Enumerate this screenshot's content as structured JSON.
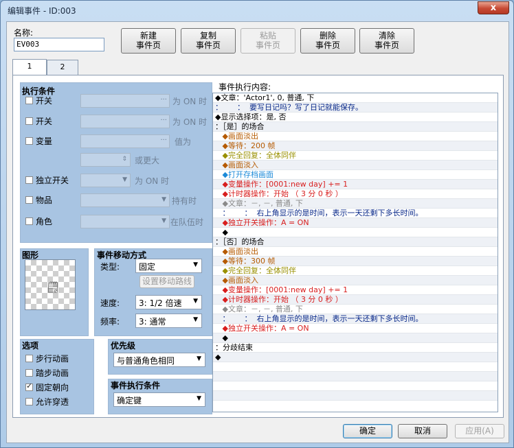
{
  "window": {
    "title": "编辑事件 - ID:003",
    "close_label": "x"
  },
  "header": {
    "name_label": "名称:",
    "name_value": "EV003",
    "buttons": [
      {
        "label1": "新建",
        "label2": "事件页"
      },
      {
        "label1": "复制",
        "label2": "事件页"
      },
      {
        "label1": "粘贴",
        "label2": "事件页"
      },
      {
        "label1": "删除",
        "label2": "事件页"
      },
      {
        "label1": "清除",
        "label2": "事件页"
      }
    ]
  },
  "tabs": [
    "1",
    "2"
  ],
  "conditions": {
    "title": "执行条件",
    "switch1": "开关",
    "switch1_hint": "为 ON 时",
    "switch2": "开关",
    "switch2_hint": "为 ON 时",
    "variable": "变量",
    "variable_hint": "值为",
    "variable_hint2": "或更大",
    "self_switch": "独立开关",
    "self_switch_hint": "为 ON 时",
    "item": "物品",
    "item_hint": "持有时",
    "actor": "角色",
    "actor_hint": "在队伍时"
  },
  "graphic": {
    "title": "图形"
  },
  "movement": {
    "title": "事件移动方式",
    "type_label": "类型:",
    "type_value": "固定",
    "route_button": "设置移动路线",
    "speed_label": "速度:",
    "speed_value": "3: 1/2 倍速",
    "freq_label": "频率:",
    "freq_value": "3: 通常"
  },
  "options": {
    "title": "选项",
    "items": [
      {
        "label": "步行动画",
        "checked": false
      },
      {
        "label": "踏步动画",
        "checked": false
      },
      {
        "label": "固定朝向",
        "checked": true
      },
      {
        "label": "允许穿透",
        "checked": false
      }
    ]
  },
  "priority": {
    "title": "优先级",
    "value": "与普通角色相同"
  },
  "trigger": {
    "title": "事件执行条件",
    "value": "确定键"
  },
  "contents": {
    "label": "事件执行内容:",
    "lines": [
      {
        "text": "◆文章：'Actor1', 0, 普通, 下",
        "color": "c-black"
      },
      {
        "text": "：      ：  要写日记吗？写了日记就能保存。",
        "color": "c-dblue"
      },
      {
        "text": "◆显示选择项：是, 否",
        "color": "c-black"
      },
      {
        "text": "：［是］的场合",
        "color": "c-black"
      },
      {
        "text": "   ◆画面淡出",
        "color": "c-orange"
      },
      {
        "text": "   ◆等待：200 帧",
        "color": "c-orange"
      },
      {
        "text": "   ◆完全回复：全体同伴",
        "color": "c-olive"
      },
      {
        "text": "   ◆画面淡入",
        "color": "c-orange"
      },
      {
        "text": "   ◆打开存档画面",
        "color": "c-cyan"
      },
      {
        "text": "   ◆变量操作：[0001:new day] += 1",
        "color": "c-red"
      },
      {
        "text": "   ◆计时器操作：开始 （ 3 分 0 秒 ）",
        "color": "c-red"
      },
      {
        "text": "   ◆文章：－, －, 普通, 下",
        "color": "c-gray"
      },
      {
        "text": "   ：      ：  右上角显示的是时间，表示一天还剩下多长时间。",
        "color": "c-dblue"
      },
      {
        "text": "   ◆独立开关操作：A = ON",
        "color": "c-red"
      },
      {
        "text": "   ◆",
        "color": "c-black"
      },
      {
        "text": "：［否］的场合",
        "color": "c-black"
      },
      {
        "text": "   ◆画面淡出",
        "color": "c-orange"
      },
      {
        "text": "   ◆等待：300 帧",
        "color": "c-orange"
      },
      {
        "text": "   ◆完全回复：全体同伴",
        "color": "c-olive"
      },
      {
        "text": "   ◆画面淡入",
        "color": "c-orange"
      },
      {
        "text": "   ◆变量操作：[0001:new day] += 1",
        "color": "c-red"
      },
      {
        "text": "   ◆计时器操作：开始 （ 3 分 0 秒 ）",
        "color": "c-red"
      },
      {
        "text": "   ◆文章：－, －, 普通, 下",
        "color": "c-gray"
      },
      {
        "text": "   ：      ：  右上角显示的是时间，表示一天还剩下多长时间。",
        "color": "c-dblue"
      },
      {
        "text": "   ◆独立开关操作：A = ON",
        "color": "c-red"
      },
      {
        "text": "   ◆",
        "color": "c-black"
      },
      {
        "text": "：分歧结束",
        "color": "c-black"
      },
      {
        "text": "◆",
        "color": "c-black"
      },
      {
        "text": "",
        "color": "c-black"
      },
      {
        "text": "",
        "color": "c-black"
      },
      {
        "text": "",
        "color": "c-black"
      },
      {
        "text": "",
        "color": "c-black"
      }
    ]
  },
  "footer": {
    "ok": "确定",
    "cancel": "取消",
    "apply": "应用(A)"
  }
}
